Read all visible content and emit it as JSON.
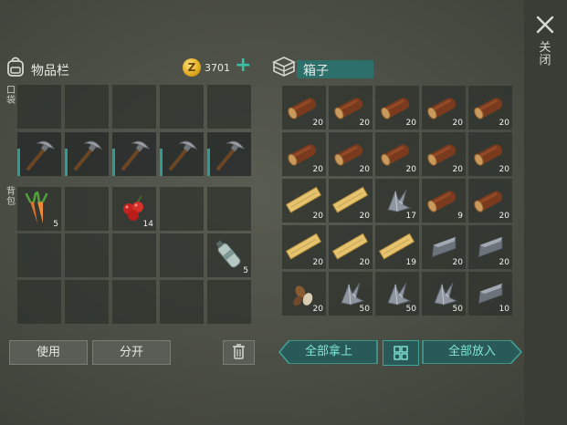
{
  "close_label": "关闭",
  "inventory": {
    "title": "物品栏",
    "coins": "3701",
    "pocket_label": "口袋",
    "backpack_label": "背包",
    "use_label": "使用",
    "split_label": "分开"
  },
  "box": {
    "title": "箱子",
    "take_all_label": "全部拿上",
    "put_all_label": "全部放入"
  },
  "colors": {
    "accent": "#37c1a4",
    "teal_button": "#2a5a58",
    "coin_gold": "#e0a91c"
  },
  "pocket_slots": [
    {
      "item": "",
      "qty": ""
    },
    {
      "item": "",
      "qty": ""
    },
    {
      "item": "",
      "qty": ""
    },
    {
      "item": "",
      "qty": ""
    },
    {
      "item": "",
      "qty": ""
    },
    {
      "item": "pickaxe",
      "qty": ""
    },
    {
      "item": "pickaxe",
      "qty": ""
    },
    {
      "item": "pickaxe",
      "qty": ""
    },
    {
      "item": "pickaxe",
      "qty": ""
    },
    {
      "item": "pickaxe",
      "qty": ""
    }
  ],
  "backpack_slots": [
    {
      "item": "carrots",
      "qty": "5"
    },
    {
      "item": "",
      "qty": ""
    },
    {
      "item": "berries",
      "qty": "14"
    },
    {
      "item": "",
      "qty": ""
    },
    {
      "item": "",
      "qty": ""
    },
    {
      "item": "",
      "qty": ""
    },
    {
      "item": "",
      "qty": ""
    },
    {
      "item": "",
      "qty": ""
    },
    {
      "item": "",
      "qty": ""
    },
    {
      "item": "water-bottle",
      "qty": "5"
    },
    {
      "item": "",
      "qty": ""
    },
    {
      "item": "",
      "qty": ""
    },
    {
      "item": "",
      "qty": ""
    },
    {
      "item": "",
      "qty": ""
    },
    {
      "item": "",
      "qty": ""
    }
  ],
  "box_slots": [
    {
      "item": "log",
      "qty": "20"
    },
    {
      "item": "log",
      "qty": "20"
    },
    {
      "item": "log",
      "qty": "20"
    },
    {
      "item": "log",
      "qty": "20"
    },
    {
      "item": "log",
      "qty": "20"
    },
    {
      "item": "log",
      "qty": "20"
    },
    {
      "item": "log",
      "qty": "20"
    },
    {
      "item": "log",
      "qty": "20"
    },
    {
      "item": "log",
      "qty": "20"
    },
    {
      "item": "log",
      "qty": "20"
    },
    {
      "item": "plank",
      "qty": "20"
    },
    {
      "item": "plank",
      "qty": "20"
    },
    {
      "item": "metal-scrap",
      "qty": "17"
    },
    {
      "item": "log",
      "qty": "9"
    },
    {
      "item": "log",
      "qty": "20"
    },
    {
      "item": "plank",
      "qty": "20"
    },
    {
      "item": "plank",
      "qty": "20"
    },
    {
      "item": "plank",
      "qty": "19"
    },
    {
      "item": "iron-ingot",
      "qty": "20"
    },
    {
      "item": "iron-ingot",
      "qty": "20"
    },
    {
      "item": "seeds",
      "qty": "20"
    },
    {
      "item": "metal-scrap",
      "qty": "50"
    },
    {
      "item": "metal-scrap",
      "qty": "50"
    },
    {
      "item": "metal-scrap",
      "qty": "50"
    },
    {
      "item": "iron-ingot",
      "qty": "10"
    }
  ]
}
